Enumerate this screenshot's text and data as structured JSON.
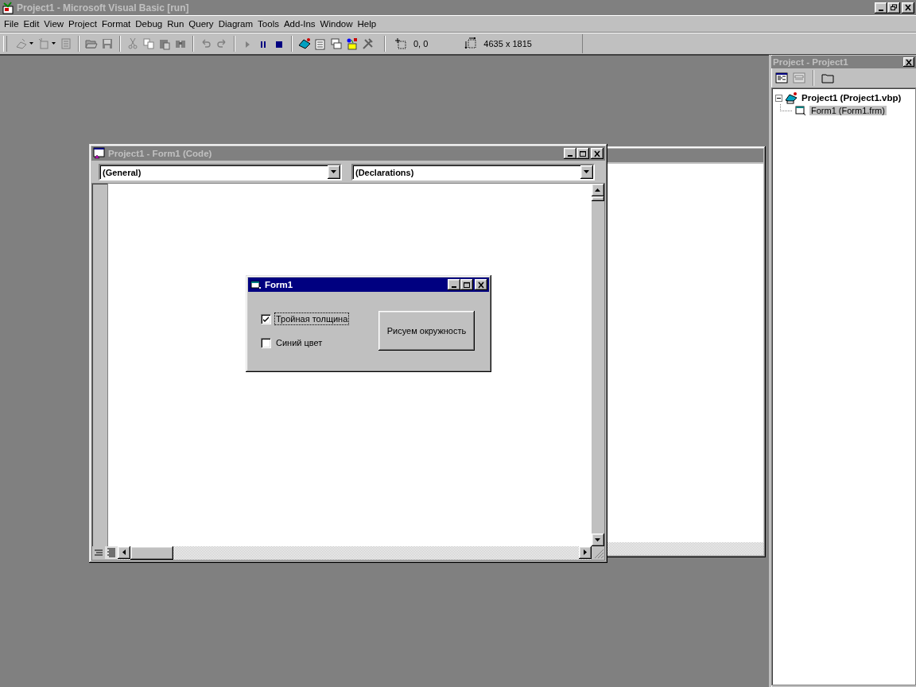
{
  "window": {
    "title": "Project1 - Microsoft Visual Basic [run]"
  },
  "menu": [
    "File",
    "Edit",
    "View",
    "Project",
    "Format",
    "Debug",
    "Run",
    "Query",
    "Diagram",
    "Tools",
    "Add-Ins",
    "Window",
    "Help"
  ],
  "toolbar": {
    "position": "0, 0",
    "size": "4635 x 1815"
  },
  "code_window": {
    "title": "Project1 - Form1 (Code)",
    "object_combo": "(General)",
    "procedure_combo": "(Declarations)"
  },
  "form_window": {
    "title": "Form1",
    "checkboxes": [
      {
        "label": "Тройная толщина",
        "checked": true,
        "focused": true
      },
      {
        "label": "Синий цвет",
        "checked": false,
        "focused": false
      }
    ],
    "button": "Рисуем окружность"
  },
  "project_panel": {
    "title": "Project - Project1",
    "tree": [
      {
        "label": "Project1 (Project1.vbp)",
        "selected": false,
        "expanded": true,
        "children": [
          {
            "label": "Form1 (Form1.frm)",
            "selected": true
          }
        ]
      }
    ]
  }
}
